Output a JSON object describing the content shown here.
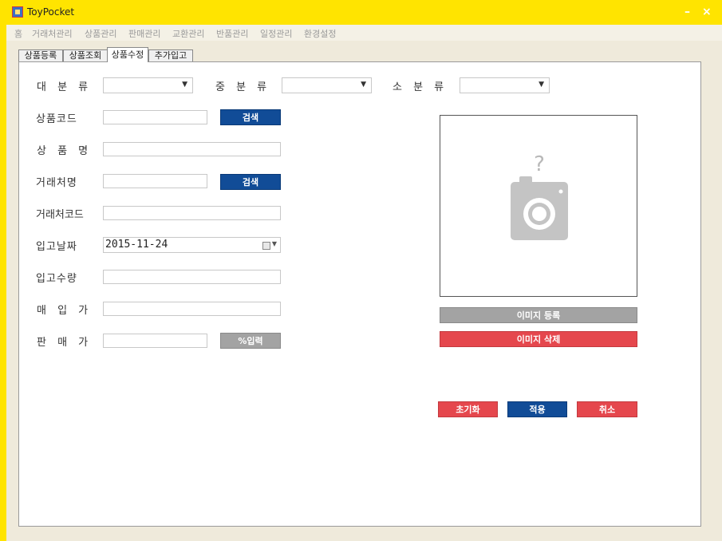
{
  "window": {
    "title": "ToyPocket",
    "minimize": "–",
    "close": "×",
    "colors": {
      "frame": "#ffe400",
      "blue_button": "#114c97",
      "gray_button": "#a3a3a3",
      "red_button": "#e5474d"
    }
  },
  "menu": [
    "홈",
    "거래처관리",
    "상품관리",
    "판매관리",
    "교환관리",
    "반품관리",
    "일정관리",
    "환경설정"
  ],
  "tabs": [
    "상품등록",
    "상품조회",
    "상품수정",
    "추가입고"
  ],
  "active_tab": "상품수정",
  "form": {
    "major_category_label": "대 분 류",
    "middle_category_label": "중 분 류",
    "minor_category_label": "소 분 류",
    "product_code_label": "상품코드",
    "product_name_label": "상 품 명",
    "vendor_name_label": "거래처명",
    "vendor_code_label": "거래처코드",
    "receive_date_label": "입고날짜",
    "receive_date_value": "2015-11-24",
    "receive_qty_label": "입고수량",
    "purchase_price_label": "매 입 가",
    "sale_price_label": "판 매 가",
    "search_label": "검색",
    "percent_input_label": "%입력"
  },
  "image_panel": {
    "placeholder_icon": "camera-question-icon",
    "register_label": "이미지 등록",
    "delete_label": "이미지 삭제"
  },
  "actions": {
    "reset_label": "초기화",
    "apply_label": "적용",
    "cancel_label": "취소"
  }
}
